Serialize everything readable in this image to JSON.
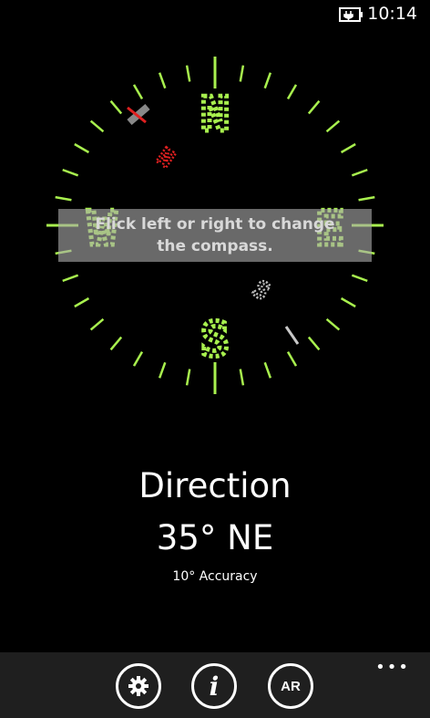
{
  "status": {
    "time": "10:14",
    "battery_icon": "battery-charging-icon"
  },
  "compass": {
    "cardinals": [
      "N",
      "E",
      "S",
      "W"
    ],
    "secondary_markers": [
      "N",
      "S"
    ],
    "tick_color": "#a8f04e",
    "needle_north_color": "#e02020",
    "needle_south_color": "#c8c8c8"
  },
  "hint": {
    "text": "Flick left or right to change the compass."
  },
  "readout": {
    "label": "Direction",
    "value": "35° NE",
    "accuracy": "10°  Accuracy"
  },
  "app_bar": {
    "more": "•••",
    "buttons": [
      {
        "icon": "settings-gear-icon",
        "glyph": "⚙"
      },
      {
        "icon": "info-icon",
        "glyph": "i"
      },
      {
        "icon": "ar-icon",
        "glyph": "AR"
      }
    ]
  }
}
